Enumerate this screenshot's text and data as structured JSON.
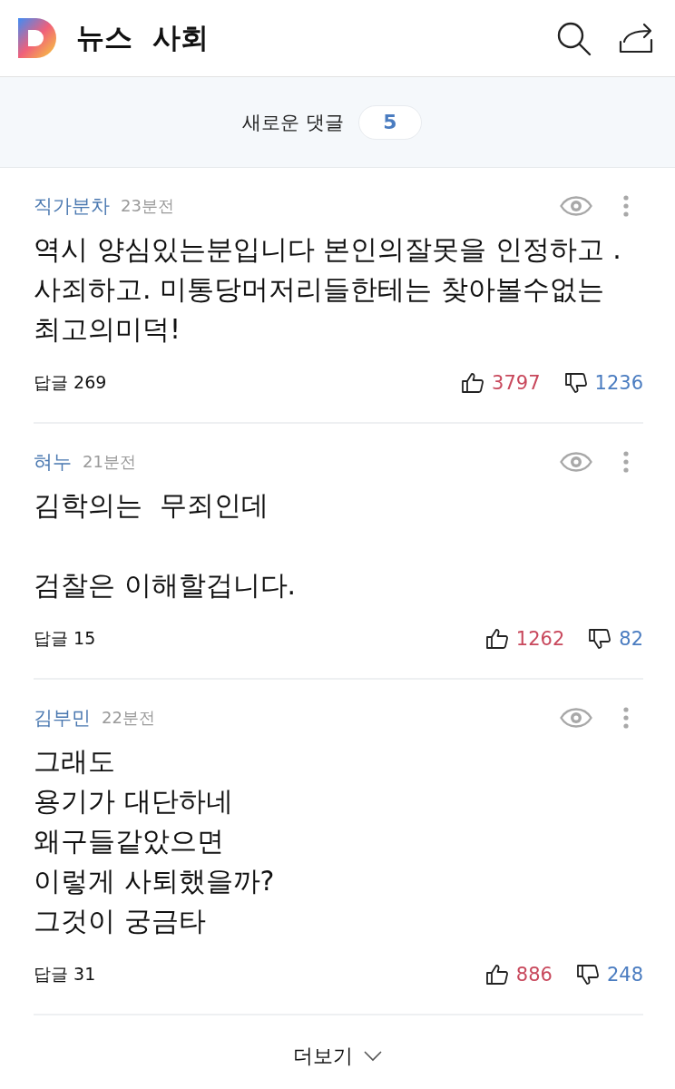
{
  "header": {
    "title": "뉴스",
    "section": "사회"
  },
  "new_comments": {
    "label": "새로운 댓글",
    "count": "5"
  },
  "comments": [
    {
      "author": "직가분차",
      "time": "23분전",
      "text": "역시 양심있는분입니다 본인의잘못을 인정하고 . 사죄하고. 미통당머저리들한테는 찾아볼수없는 최고의미덕!",
      "replies": "답글 269",
      "likes": "3797",
      "dislikes": "1236"
    },
    {
      "author": "혀누",
      "time": "21분전",
      "text": "김학의는  무죄인데\n\n검찰은 이해할겁니다.",
      "replies": "답글 15",
      "likes": "1262",
      "dislikes": "82"
    },
    {
      "author": "김부민",
      "time": "22분전",
      "text": "그래도\n용기가 대단하네\n왜구들같았으면\n이렇게 사퇴했을까?\n그것이 궁금타",
      "replies": "답글 31",
      "likes": "886",
      "dislikes": "248"
    }
  ],
  "more": {
    "label": "더보기"
  }
}
